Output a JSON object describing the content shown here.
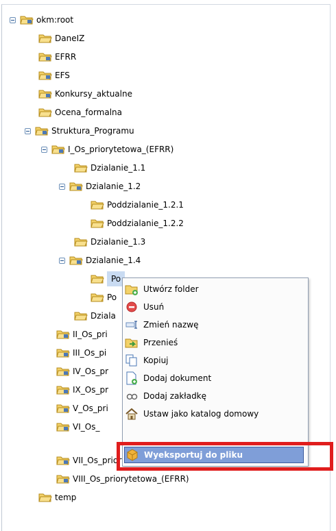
{
  "tree": {
    "root": "okm:root",
    "items": [
      "DaneIZ",
      "EFRR",
      "EFS",
      "Konkursy_aktualne",
      "Ocena_formalna",
      "Struktura_Programu",
      "I_Os_priorytetowa_(EFRR)",
      "Dzialanie_1.1",
      "Dzialanie_1.2",
      "Poddzialanie_1.2.1",
      "Poddzialanie_1.2.2",
      "Dzialanie_1.3",
      "Dzialanie_1.4",
      "Po",
      "Po",
      "Dziala",
      "II_Os_pri",
      "III_Os_pi",
      "IV_Os_pr",
      "IX_Os_pr",
      "V_Os_pri",
      "VI_Os_",
      "VII_Os_priorytetowa_(EFS)",
      "VIII_Os_priorytetowa_(EFRR)",
      "temp"
    ]
  },
  "context_menu": {
    "items": [
      {
        "label": "Utwórz folder",
        "icon": "new-folder-icon"
      },
      {
        "label": "Usuń",
        "icon": "delete-icon"
      },
      {
        "label": "Zmień nazwę",
        "icon": "rename-icon"
      },
      {
        "label": "Przenieś",
        "icon": "move-icon"
      },
      {
        "label": "Kopiuj",
        "icon": "copy-icon"
      },
      {
        "label": "Dodaj dokument",
        "icon": "add-document-icon"
      },
      {
        "label": "Dodaj zakładkę",
        "icon": "bookmark-icon"
      },
      {
        "label": "Ustaw jako katalog domowy",
        "icon": "home-icon"
      },
      {
        "label": "Wyeksportuj do pliku",
        "icon": "export-icon"
      }
    ],
    "active_item": "Wyeksportuj do pliku"
  },
  "colors": {
    "highlight_border": "#e01d1d",
    "menu_active": "#7f9ed8",
    "folder_yellow": "#f3d26a"
  }
}
